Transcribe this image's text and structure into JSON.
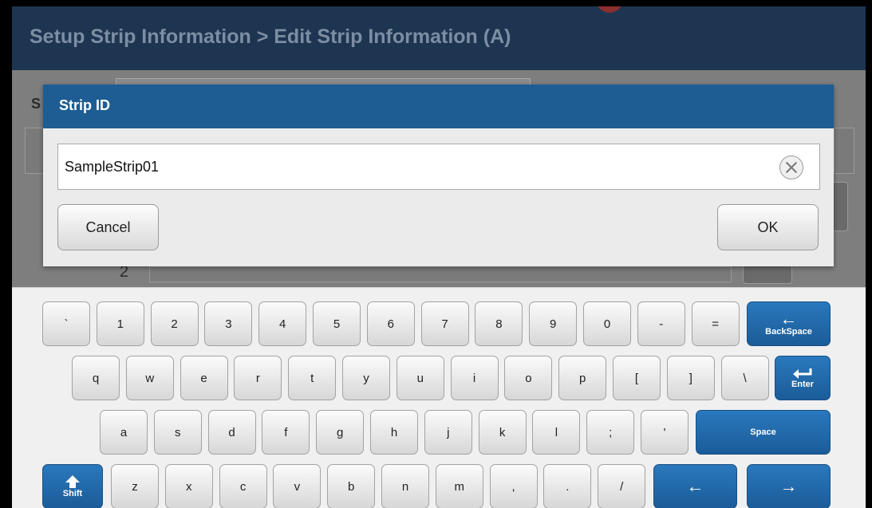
{
  "header": {
    "title": "Setup Strip Information > Edit Strip Information (A)"
  },
  "background": {
    "label_fragment": "S",
    "row_number": "2"
  },
  "dialog": {
    "title": "Strip ID",
    "input_value": "SampleStrip01",
    "cancel_label": "Cancel",
    "ok_label": "OK"
  },
  "keyboard": {
    "row1": [
      "`",
      "1",
      "2",
      "3",
      "4",
      "5",
      "6",
      "7",
      "8",
      "9",
      "0",
      "-",
      "="
    ],
    "backspace_label": "BackSpace",
    "row2": [
      "q",
      "w",
      "e",
      "r",
      "t",
      "y",
      "u",
      "i",
      "o",
      "p",
      "[",
      "]",
      "\\"
    ],
    "enter_label": "Enter",
    "row3": [
      "a",
      "s",
      "d",
      "f",
      "g",
      "h",
      "j",
      "k",
      "l",
      ";",
      "'"
    ],
    "space_label": "Space",
    "shift_label": "Shift",
    "row4": [
      "z",
      "x",
      "c",
      "v",
      "b",
      "n",
      "m",
      ",",
      ".",
      "/"
    ],
    "arrow_left": "←",
    "arrow_right": "→",
    "backspace_arrow": "←"
  }
}
